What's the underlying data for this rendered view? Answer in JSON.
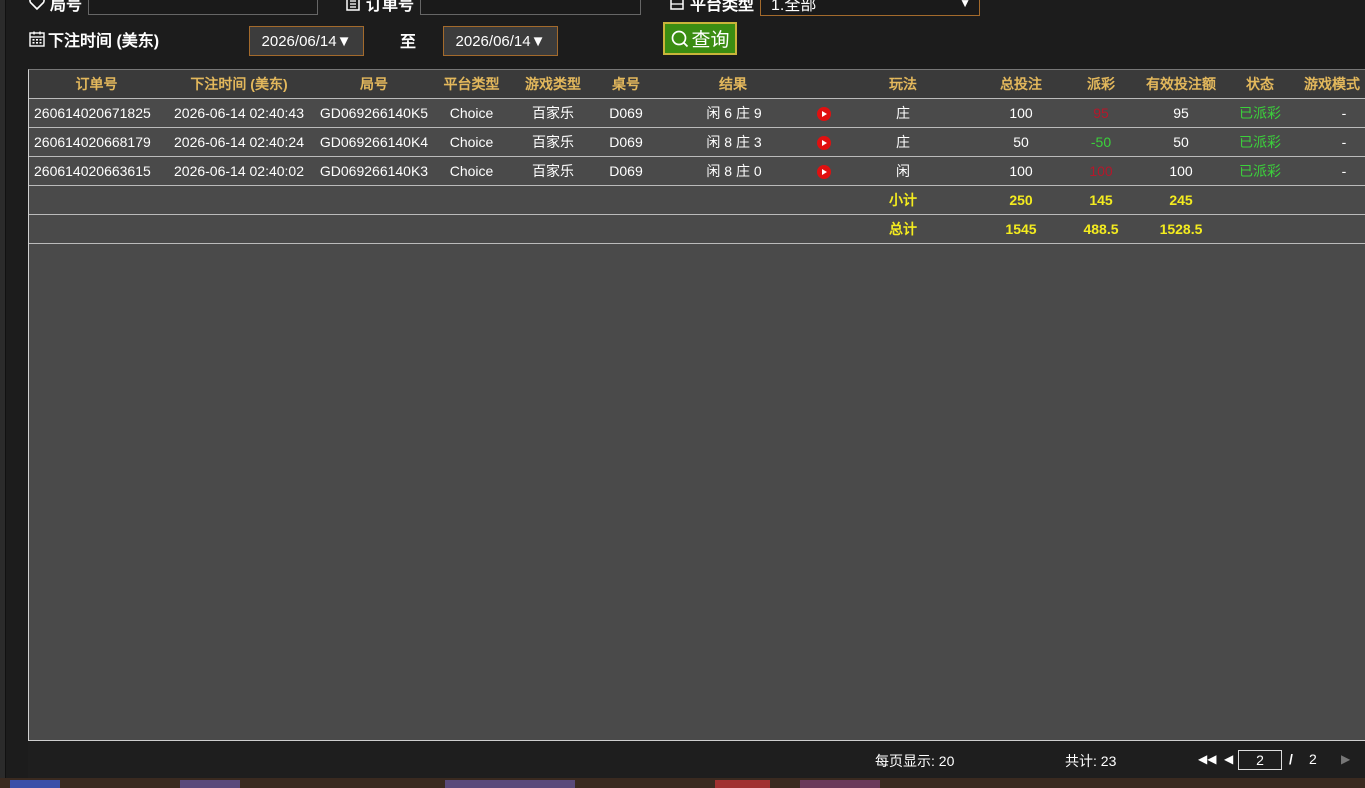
{
  "filters": {
    "round_label": "局号",
    "order_label": "订单号",
    "platform_label": "平台类型",
    "platform_value": "1.全部",
    "time_label": "下注时间 (美东)",
    "date_from": "2026/06/14▼",
    "to_label": "至",
    "date_to": "2026/06/14▼",
    "query_label": "查询"
  },
  "table": {
    "headers": [
      "订单号",
      "下注时间 (美东)",
      "局号",
      "平台类型",
      "游戏类型",
      "桌号",
      "结果",
      "玩法",
      "总投注",
      "派彩",
      "有效投注额",
      "状态",
      "游戏模式"
    ],
    "rows": [
      {
        "order": "260614020671825",
        "time": "2026-06-14 02:40:43",
        "round": "GD069266140K5",
        "platform": "Choice",
        "game": "百家乐",
        "table": "D069",
        "result": "闲 6 庄 9",
        "bet_type": "庄",
        "total": "100",
        "payout": "95",
        "payout_color": "#b5172b",
        "valid": "95",
        "status": "已派彩",
        "mode": "-"
      },
      {
        "order": "260614020668179",
        "time": "2026-06-14 02:40:24",
        "round": "GD069266140K4",
        "platform": "Choice",
        "game": "百家乐",
        "table": "D069",
        "result": "闲 8 庄 3",
        "bet_type": "庄",
        "total": "50",
        "payout": "-50",
        "payout_color": "#3bd13b",
        "valid": "50",
        "status": "已派彩",
        "mode": "-"
      },
      {
        "order": "260614020663615",
        "time": "2026-06-14 02:40:02",
        "round": "GD069266140K3",
        "platform": "Choice",
        "game": "百家乐",
        "table": "D069",
        "result": "闲 8 庄 0",
        "bet_type": "闲",
        "total": "100",
        "payout": "100",
        "payout_color": "#b5172b",
        "valid": "100",
        "status": "已派彩",
        "mode": "-"
      }
    ],
    "subtotal": {
      "label": "小计",
      "total": "250",
      "payout": "145",
      "valid": "245"
    },
    "grand_total": {
      "label": "总计",
      "total": "1545",
      "payout": "488.5",
      "valid": "1528.5"
    }
  },
  "footer": {
    "per_page": "每页显示: 20",
    "total_count": "共计: 23",
    "page_current": "2",
    "page_sep": "/",
    "page_total": "2"
  },
  "colors": {
    "header_text": "#e3b85c",
    "highlight": "#f4ec1f",
    "status_green": "#3bd13b",
    "payout_red": "#b5172b",
    "query_green": "#3b8d12"
  }
}
